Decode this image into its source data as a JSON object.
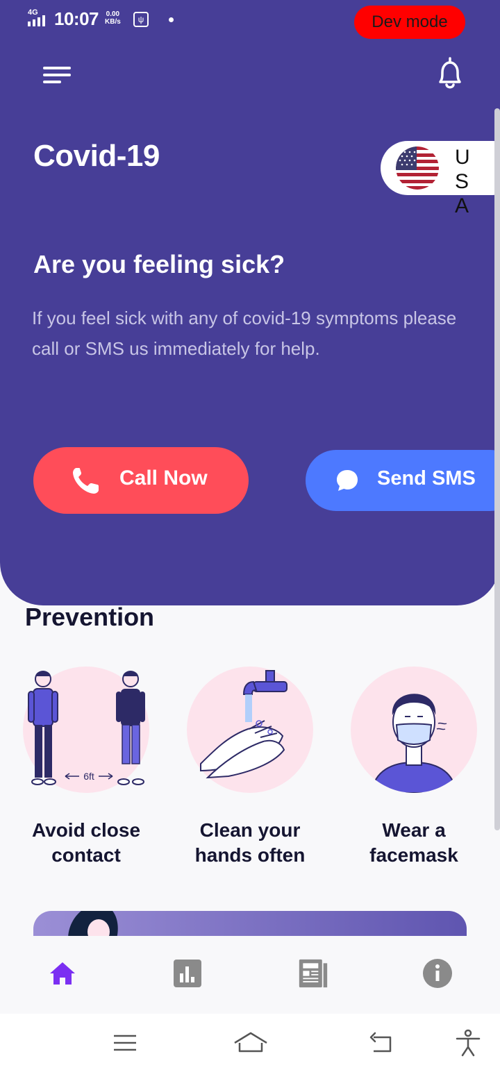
{
  "status_bar": {
    "network": "4G",
    "time": "10:07",
    "speed_value": "0.00",
    "speed_unit": "KB/s",
    "dev_mode": "Dev mode"
  },
  "header": {
    "title": "Covid-19",
    "country": "USA"
  },
  "alert": {
    "question": "Are you feeling sick?",
    "description": "If you feel sick with any of covid-19 symptoms please call or SMS us immediately for help.",
    "call_label": "Call Now",
    "sms_label": "Send SMS"
  },
  "prevention": {
    "title": "Prevention",
    "items": [
      {
        "caption_line1": "Avoid close",
        "caption_line2": "contact",
        "distance_label": "6ft"
      },
      {
        "caption_line1": "Clean your",
        "caption_line2": "hands often"
      },
      {
        "caption_line1": "Wear a",
        "caption_line2": "facemask"
      }
    ]
  },
  "bottom_nav": {
    "items": [
      {
        "icon": "home-icon",
        "active": true
      },
      {
        "icon": "stats-icon",
        "active": false
      },
      {
        "icon": "news-icon",
        "active": false
      },
      {
        "icon": "info-icon",
        "active": false
      }
    ]
  },
  "colors": {
    "primary": "#473e97",
    "call": "#ff4d59",
    "sms": "#4d79ff",
    "dev_mode": "#ff0000",
    "nav_active": "#7b2ff2",
    "nav_inactive": "#8a8a8a"
  }
}
